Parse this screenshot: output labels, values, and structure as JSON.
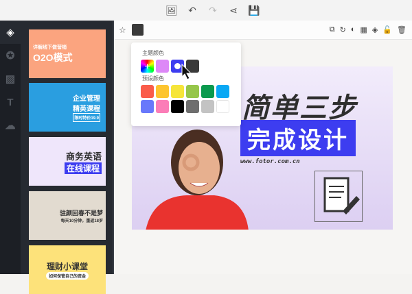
{
  "topbar": {
    "icons": [
      "image-icon",
      "undo-icon",
      "redo-icon",
      "share-icon",
      "save-icon"
    ]
  },
  "rail": {
    "icons": [
      "layers-icon",
      "star-icon",
      "texture-icon",
      "text-icon",
      "upload-icon"
    ]
  },
  "templates": [
    {
      "line1": "详解线下做营销",
      "line2": "O2O模式",
      "bg": "#fba47f",
      "color": "#fff"
    },
    {
      "line1": "企业管理",
      "line2": "精英课程",
      "line3": "限时特价19.9",
      "bg": "#2a9ee0",
      "color": "#fff"
    },
    {
      "line1": "商务英语",
      "line2": "在线课程",
      "bg": "#efe6fb",
      "color": "#2d2d2d"
    },
    {
      "line1": "驻颜回春不是梦",
      "line2": "每天10分钟，重返18岁",
      "bg": "#e2dbd0",
      "color": "#333"
    },
    {
      "line1": "理财小课堂",
      "line2": "如何保管自己的资金",
      "bg": "#fde27a",
      "color": "#333"
    }
  ],
  "toolbar": {
    "current_color": "#3a3a3a",
    "tools": [
      "duplicate-icon",
      "rotate-icon",
      "mask-icon",
      "transparency-icon",
      "layer-icon",
      "lock-icon",
      "delete-icon"
    ]
  },
  "color_popup": {
    "theme_label": "主题颜色",
    "theme_colors": [
      "#dd88f7",
      "#3d3df0",
      "#3a3a3a"
    ],
    "preset_label": "预设颜色",
    "preset_colors": [
      "#fa5c4a",
      "#fdc530",
      "#f6e53a",
      "#96c64a",
      "#0b9a4e",
      "#0aa8f4",
      "#6878fb",
      "#fb7db7",
      "#000000",
      "#6e6e6e",
      "#c3c3c3",
      "#ffffff"
    ]
  },
  "design": {
    "headline": "简单三步",
    "subhead": "完成设计",
    "url": "www.fotor.com.cn"
  }
}
